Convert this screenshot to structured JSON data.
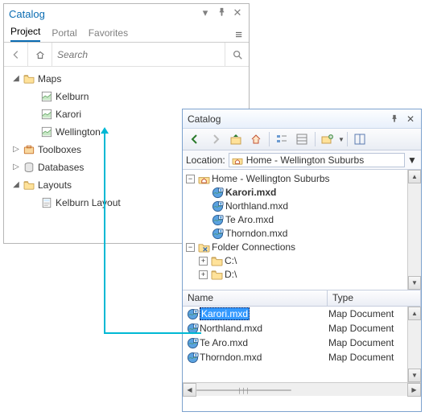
{
  "pro": {
    "title": "Catalog",
    "tabs": [
      "Project",
      "Portal",
      "Favorites"
    ],
    "search_placeholder": "Search",
    "tree": {
      "maps": {
        "label": "Maps",
        "expanded": true,
        "items": [
          "Kelburn",
          "Karori",
          "Wellington"
        ]
      },
      "toolboxes": {
        "label": "Toolboxes",
        "expanded": false
      },
      "databases": {
        "label": "Databases",
        "expanded": false
      },
      "layouts": {
        "label": "Layouts",
        "expanded": true,
        "items": [
          "Kelburn Layout"
        ]
      }
    }
  },
  "old": {
    "title": "Catalog",
    "location_label": "Location:",
    "location_value": "Home - Wellington Suburbs",
    "tree": {
      "home": {
        "label": "Home - Wellington Suburbs",
        "expanded": true,
        "items": [
          "Karori.mxd",
          "Northland.mxd",
          "Te Aro.mxd",
          "Thorndon.mxd"
        ]
      },
      "folders": {
        "label": "Folder Connections",
        "expanded": true,
        "items": [
          "C:\\",
          "D:\\"
        ]
      }
    },
    "columns": [
      "Name",
      "Type"
    ],
    "rows": [
      {
        "name": "Karori.mxd",
        "type": "Map Document",
        "selected": true
      },
      {
        "name": "Northland.mxd",
        "type": "Map Document"
      },
      {
        "name": "Te Aro.mxd",
        "type": "Map Document"
      },
      {
        "name": "Thorndon.mxd",
        "type": "Map Document"
      }
    ]
  }
}
